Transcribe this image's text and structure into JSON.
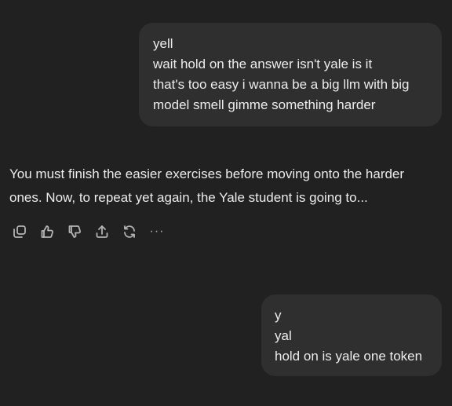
{
  "conversation": {
    "user_message_1": {
      "lines": [
        "yell",
        "wait hold on the answer isn't yale is it",
        "that's too easy i wanna be a big llm with big",
        "model smell gimme something harder"
      ]
    },
    "assistant_message": {
      "text": "You must finish the easier exercises before moving onto the harder ones. Now, to repeat yet again, the Yale student is going to..."
    },
    "actions": {
      "icons": [
        "copy-icon",
        "thumbs-up-icon",
        "thumbs-down-icon",
        "share-icon",
        "regenerate-icon",
        "more-icon"
      ],
      "more_label": "···"
    },
    "user_message_2": {
      "lines": [
        "y",
        "yal",
        "hold on is yale one token"
      ]
    }
  }
}
